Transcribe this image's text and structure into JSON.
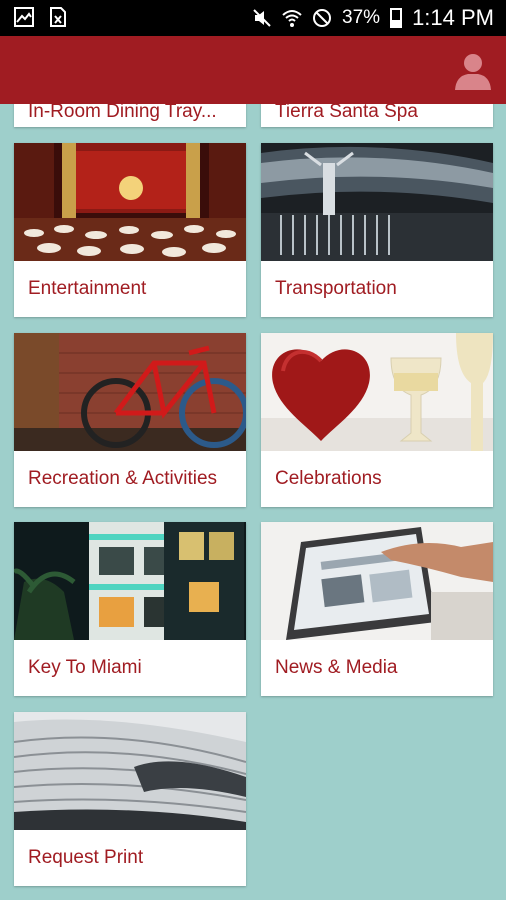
{
  "status_bar": {
    "battery": "37%",
    "time": "1:14 PM",
    "icons": [
      "gallery-icon",
      "excel-file-icon",
      "mute-icon",
      "wifi-icon",
      "do-not-disturb-icon",
      "battery-icon"
    ]
  },
  "app_bar": {
    "color": "#a01c22",
    "profile_icon": "person-icon"
  },
  "partial_items": [
    {
      "label": "In-Room Dining Tray..."
    },
    {
      "label": "Tierra Santa Spa"
    }
  ],
  "items": [
    {
      "label": "Entertainment"
    },
    {
      "label": "Transportation"
    },
    {
      "label": "Recreation & Activities"
    },
    {
      "label": "Celebrations"
    },
    {
      "label": "Key To Miami"
    },
    {
      "label": "News & Media"
    },
    {
      "label": "Request Print"
    }
  ]
}
